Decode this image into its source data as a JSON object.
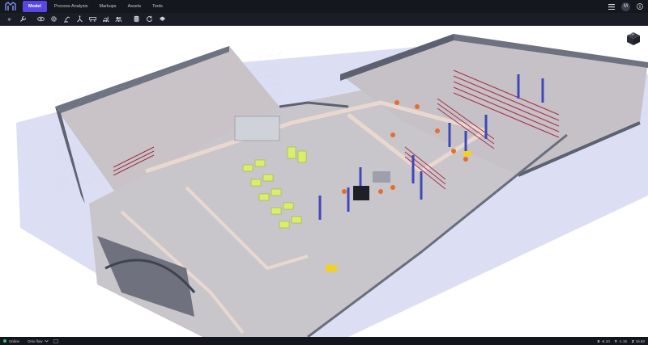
{
  "app": {
    "logo_icon": "logo-icon"
  },
  "nav": {
    "tabs": [
      {
        "label": "Model",
        "active": true
      },
      {
        "label": "Process Analysis",
        "active": false
      },
      {
        "label": "Markups",
        "active": false
      },
      {
        "label": "Assets",
        "active": false
      },
      {
        "label": "Tools",
        "active": false
      }
    ]
  },
  "user": {
    "avatar_initial": "M"
  },
  "viewcube": {
    "label": "TOP"
  },
  "status": {
    "connection": "Online",
    "flow": "Onix flow",
    "x_label": "X",
    "x_value": "-6.10",
    "y_label": "Y",
    "y_value": "-1.15",
    "z_label": "Z",
    "z_value": "15.60"
  },
  "colors": {
    "accent": "#5a46e6",
    "online": "#38c46a"
  }
}
